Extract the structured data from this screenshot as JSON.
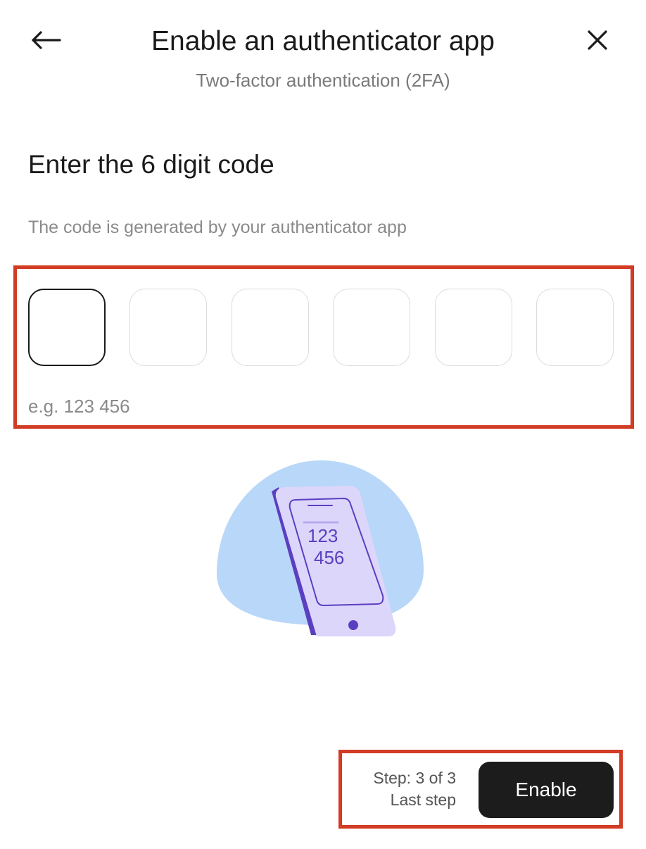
{
  "header": {
    "title": "Enable an authenticator app",
    "subtitle": "Two-factor authentication (2FA)",
    "back_icon": "arrow-left-icon",
    "close_icon": "close-icon"
  },
  "section": {
    "heading": "Enter the 6 digit code",
    "description": "The code is generated by your authenticator app"
  },
  "code_input": {
    "digit_count": 6,
    "values": [
      "",
      "",
      "",
      "",
      "",
      ""
    ],
    "focused_index": 0,
    "hint": "e.g. 123 456"
  },
  "illustration": {
    "icon": "phone-with-code-illustration",
    "code_line_1": "123",
    "code_line_2": "456"
  },
  "footer": {
    "step_label": "Step: 3 of 3",
    "step_sub": "Last step",
    "enable_label": "Enable"
  },
  "colors": {
    "highlight": "#d23b24",
    "button_bg": "#1c1c1c",
    "blob": "#b9d7f8",
    "phone_body": "#ddd6fb",
    "phone_accent": "#5a3fc0"
  }
}
